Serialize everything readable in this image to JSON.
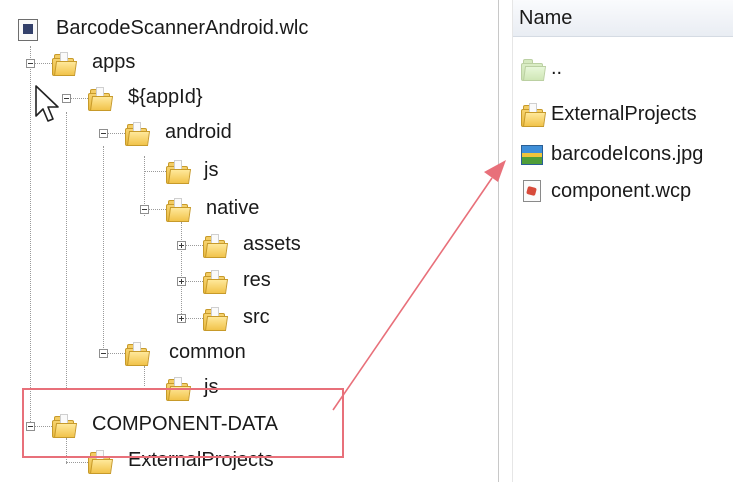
{
  "tree": {
    "root_label": "BarcodeScannerAndroid.wlc",
    "nodes": [
      {
        "label": "apps"
      },
      {
        "label": "${appId}"
      },
      {
        "label": "android"
      },
      {
        "label": "js"
      },
      {
        "label": "native"
      },
      {
        "label": "assets"
      },
      {
        "label": "res"
      },
      {
        "label": "src"
      },
      {
        "label": "common"
      },
      {
        "label": "js"
      },
      {
        "label": "COMPONENT-DATA"
      },
      {
        "label": "ExternalProjects"
      }
    ]
  },
  "file_list": {
    "header": "Name",
    "rows": [
      {
        "label": ".."
      },
      {
        "label": "ExternalProjects"
      },
      {
        "label": "barcodeIcons.jpg"
      },
      {
        "label": "component.wcp"
      }
    ]
  },
  "annotation": {
    "highlight_color": "#e8707a",
    "arrow_color": "#e8707a"
  }
}
